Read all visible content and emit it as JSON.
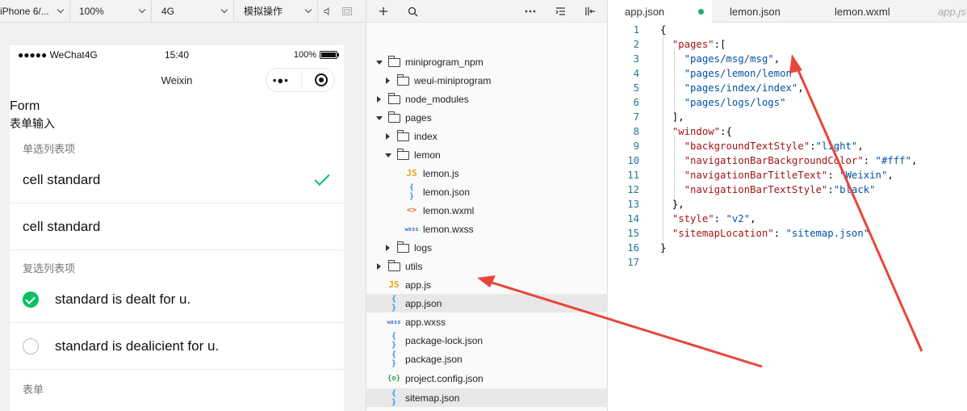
{
  "simulator": {
    "toolbar": {
      "device": "iPhone 6/...",
      "zoom": "100%",
      "network": "4G",
      "mode": "模拟操作"
    },
    "status_bar": {
      "carrier": "●●●●● WeChat4G",
      "time": "15:40",
      "battery": "100%"
    },
    "nav_title": "Weixin",
    "page_title": "Form",
    "page_subtitle": "表单输入",
    "radio_group": {
      "title": "单选列表项",
      "items": [
        {
          "label": "cell standard",
          "checked": true
        },
        {
          "label": "cell standard",
          "checked": false
        }
      ]
    },
    "checkbox_group": {
      "title": "复选列表项",
      "items": [
        {
          "label": "standard is dealt for u.",
          "checked": true
        },
        {
          "label": "standard is dealicient for u.",
          "checked": false
        }
      ]
    },
    "form_group": {
      "title": "表单"
    },
    "accent_color": "#07c160"
  },
  "explorer": {
    "items": [
      {
        "label": "miniprogram_npm",
        "type": "folder",
        "expanded": true,
        "depth": 0
      },
      {
        "label": "weui-miniprogram",
        "type": "folder",
        "expanded": false,
        "depth": 1
      },
      {
        "label": "node_modules",
        "type": "folder",
        "expanded": false,
        "depth": 0
      },
      {
        "label": "pages",
        "type": "folder",
        "expanded": true,
        "depth": 0
      },
      {
        "label": "index",
        "type": "folder",
        "expanded": false,
        "depth": 1
      },
      {
        "label": "lemon",
        "type": "folder",
        "expanded": true,
        "depth": 1
      },
      {
        "label": "lemon.js",
        "type": "js",
        "depth": 2
      },
      {
        "label": "lemon.json",
        "type": "json",
        "depth": 2
      },
      {
        "label": "lemon.wxml",
        "type": "wxml",
        "depth": 2
      },
      {
        "label": "lemon.wxss",
        "type": "wxss",
        "depth": 2
      },
      {
        "label": "logs",
        "type": "folder",
        "expanded": false,
        "depth": 1
      },
      {
        "label": "utils",
        "type": "folder",
        "expanded": false,
        "depth": 0
      },
      {
        "label": "app.js",
        "type": "js",
        "depth": 0
      },
      {
        "label": "app.json",
        "type": "json",
        "depth": 0,
        "selected": true
      },
      {
        "label": "app.wxss",
        "type": "wxss",
        "depth": 0
      },
      {
        "label": "package-lock.json",
        "type": "json",
        "depth": 0
      },
      {
        "label": "package.json",
        "type": "json",
        "depth": 0
      },
      {
        "label": "project.config.json",
        "type": "config",
        "depth": 0
      },
      {
        "label": "sitemap.json",
        "type": "json",
        "depth": 0,
        "selected": true
      }
    ],
    "icon_glyphs": {
      "js": "JS",
      "json": "{ }",
      "wxml": "<>",
      "wxss": "wxss",
      "config": "{o}"
    }
  },
  "editor": {
    "tabs": [
      {
        "label": "app.json",
        "active": true,
        "modified": true
      },
      {
        "label": "lemon.json"
      },
      {
        "label": "lemon.wxml"
      },
      {
        "label": "app.js",
        "faded": true
      }
    ],
    "lines": [
      "{",
      "  \"pages\":[",
      "    \"pages/msg/msg\",",
      "    \"pages/lemon/lemon\",",
      "    \"pages/index/index\",",
      "    \"pages/logs/logs\"",
      "  ],",
      "  \"window\":{",
      "    \"backgroundTextStyle\":\"light\",",
      "    \"navigationBarBackgroundColor\": \"#fff\",",
      "    \"navigationBarTitleText\": \"Weixin\",",
      "    \"navigationBarTextStyle\":\"black\"",
      "  },",
      "  \"style\": \"v2\",",
      "  \"sitemapLocation\": \"sitemap.json\"",
      "}",
      ""
    ]
  },
  "annotation_color": "#e8463a"
}
